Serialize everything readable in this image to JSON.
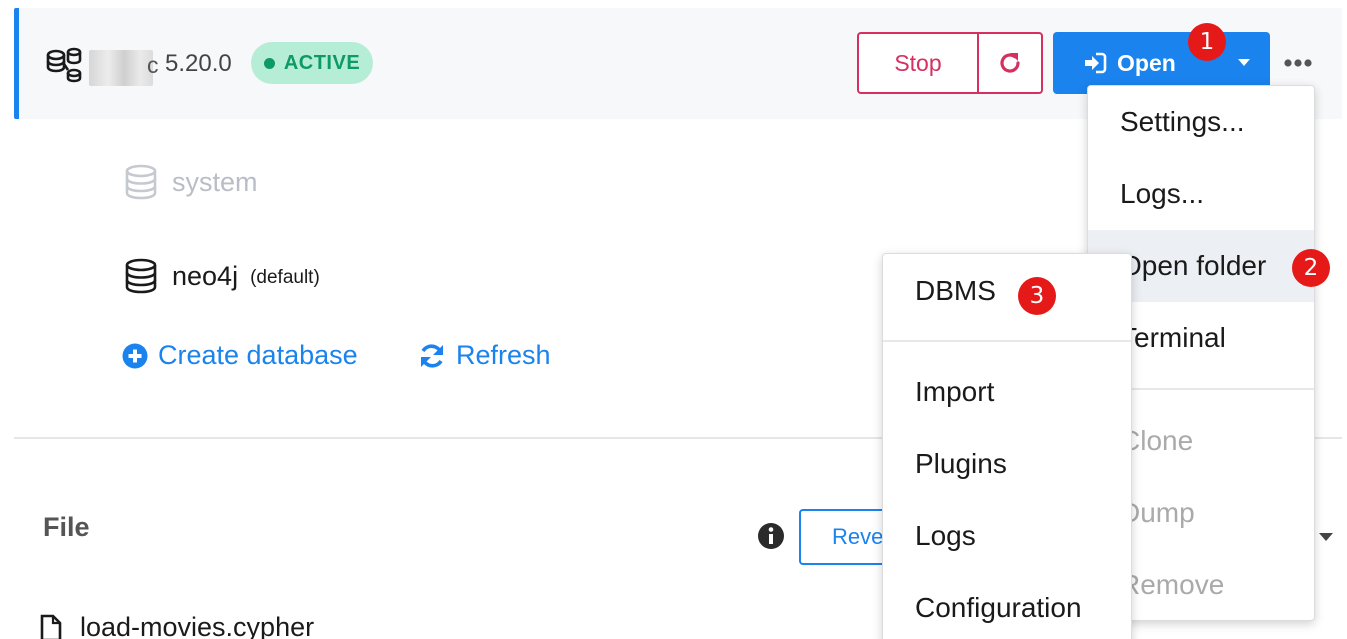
{
  "dbms": {
    "version": "5.20.0",
    "name_tail": "c",
    "status": "ACTIVE",
    "stop_label": "Stop",
    "open_label": "Open"
  },
  "databases": [
    {
      "name": "system",
      "tag": ""
    },
    {
      "name": "neo4j",
      "tag": "(default)"
    }
  ],
  "actions": {
    "create_label": "Create database",
    "refresh_label": "Refresh"
  },
  "file_section": {
    "heading": "File",
    "reveal_label": "Reveal",
    "file_name": "load-movies.cypher"
  },
  "main_menu": {
    "items": [
      {
        "label": "Settings..."
      },
      {
        "label": "Logs..."
      },
      {
        "label": "Open folder"
      },
      {
        "label": "Terminal"
      },
      {
        "label": "Clone"
      },
      {
        "label": "Dump"
      },
      {
        "label": "Remove"
      }
    ]
  },
  "sub_menu": {
    "items": [
      {
        "label": "DBMS"
      },
      {
        "label": "Import"
      },
      {
        "label": "Plugins"
      },
      {
        "label": "Logs"
      },
      {
        "label": "Configuration"
      }
    ]
  },
  "badges": [
    "1",
    "2",
    "3"
  ],
  "colors": {
    "accent": "#1a83ee",
    "danger": "#d53060",
    "active_bg": "#b6edd6",
    "active_text": "#0d9a66",
    "badge": "#e61919"
  }
}
